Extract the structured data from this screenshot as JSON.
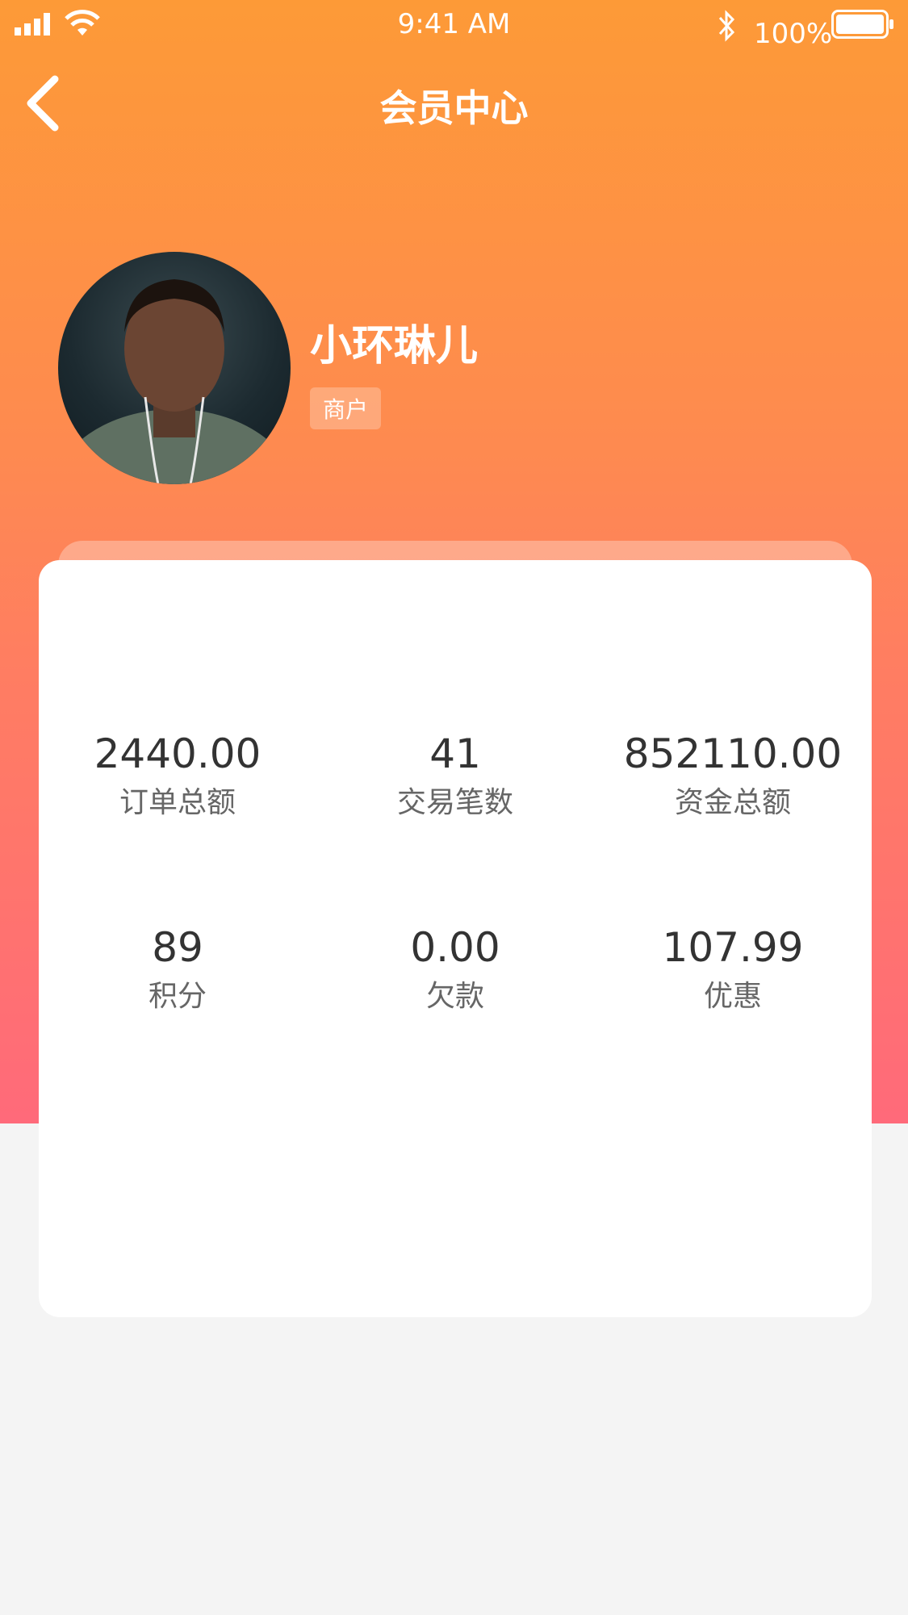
{
  "status_bar": {
    "time": "9:41 AM",
    "battery_percent": "100%",
    "icons": [
      "signal-icon",
      "wifi-icon",
      "bluetooth-icon",
      "battery-icon"
    ]
  },
  "nav": {
    "title": "会员中心",
    "back_icon": "chevron-left-icon"
  },
  "profile": {
    "name": "小环琳儿",
    "role": "商户"
  },
  "stats": [
    {
      "value": "2440.00",
      "label": "订单总额"
    },
    {
      "value": "41",
      "label": "交易笔数"
    },
    {
      "value": "852110.00",
      "label": "资金总额"
    },
    {
      "value": "89",
      "label": "积分"
    },
    {
      "value": "0.00",
      "label": "欠款"
    },
    {
      "value": "107.99",
      "label": "优惠"
    }
  ],
  "colors": {
    "header_top": "#fd9a37",
    "header_bottom": "#ff6a7a",
    "page_bg": "#f4f4f4",
    "card_bg": "#ffffff"
  }
}
